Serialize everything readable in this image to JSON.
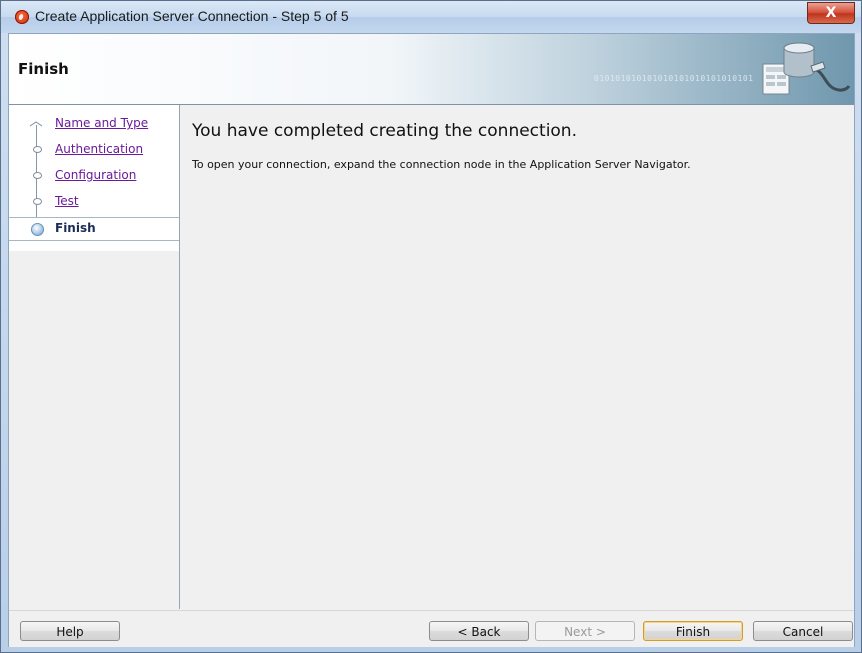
{
  "window": {
    "title": "Create Application Server Connection - Step 5 of 5",
    "close_glyph": "X"
  },
  "banner": {
    "title": "Finish",
    "binary_text": "010101010101010101010101010101"
  },
  "nav": {
    "items": [
      {
        "label": "Name and Type",
        "state": "visited"
      },
      {
        "label": "Authentication",
        "state": "visited"
      },
      {
        "label": "Configuration",
        "state": "visited"
      },
      {
        "label": "Test",
        "state": "visited"
      },
      {
        "label": "Finish",
        "state": "current"
      }
    ]
  },
  "main": {
    "heading": "You have completed creating the connection.",
    "body": "To open your connection, expand the connection node in the Application Server Navigator."
  },
  "buttons": {
    "help": "Help",
    "back": "< Back",
    "next": "Next >",
    "finish": "Finish",
    "cancel": "Cancel"
  },
  "colors": {
    "link_visited": "#6a1a9a",
    "current_step": "#1a2c58",
    "default_button_border": "#d39a2c",
    "close_button": "#c0351f"
  },
  "icons": {
    "app": "oracle-jdeveloper-icon",
    "close": "close-icon",
    "banner": "database-connection-icon",
    "step": "step-node-icon"
  }
}
